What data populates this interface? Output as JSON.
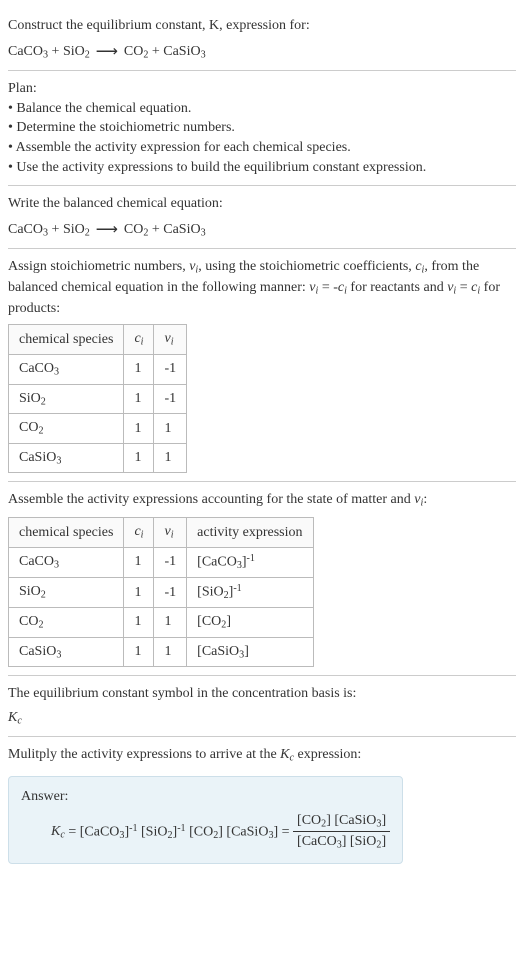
{
  "chart_data": [
    {
      "type": "table",
      "title": "stoichiometric numbers",
      "columns": [
        "chemical species",
        "c_i",
        "ν_i"
      ],
      "rows": [
        [
          "CaCO3",
          1,
          -1
        ],
        [
          "SiO2",
          1,
          -1
        ],
        [
          "CO2",
          1,
          1
        ],
        [
          "CaSiO3",
          1,
          1
        ]
      ]
    },
    {
      "type": "table",
      "title": "activity expressions",
      "columns": [
        "chemical species",
        "c_i",
        "ν_i",
        "activity expression"
      ],
      "rows": [
        [
          "CaCO3",
          1,
          -1,
          "[CaCO3]^-1"
        ],
        [
          "SiO2",
          1,
          -1,
          "[SiO2]^-1"
        ],
        [
          "CO2",
          1,
          1,
          "[CO2]"
        ],
        [
          "CaSiO3",
          1,
          1,
          "[CaSiO3]"
        ]
      ]
    }
  ],
  "s1": {
    "prompt": "Construct the equilibrium constant, K, expression for:"
  },
  "plan": {
    "heading": "Plan:",
    "b1": "• Balance the chemical equation.",
    "b2": "• Determine the stoichiometric numbers.",
    "b3": "• Assemble the activity expression for each chemical species.",
    "b4": "• Use the activity expressions to build the equilibrium constant expression."
  },
  "s3": {
    "prompt": "Write the balanced chemical equation:"
  },
  "s4": {
    "prompt_a": "Assign stoichiometric numbers, ",
    "prompt_b": ", using the stoichiometric coefficients, ",
    "prompt_c": ", from the balanced chemical equation in the following manner: ",
    "prompt_d": " for reactants and ",
    "prompt_e": " for products:",
    "h1": "chemical species",
    "r1c1": "CaCO",
    "r1c2": "1",
    "r1c3": "-1",
    "r2c1": "SiO",
    "r2c2": "1",
    "r2c3": "-1",
    "r3c1": "CO",
    "r3c2": "1",
    "r3c3": "1",
    "r4c1": "CaSiO",
    "r4c2": "1",
    "r4c3": "1"
  },
  "s5": {
    "prompt_a": "Assemble the activity expressions accounting for the state of matter and ",
    "prompt_b": ":",
    "h1": "chemical species",
    "h4": "activity expression",
    "r1c1": "CaCO",
    "r1c2": "1",
    "r1c3": "-1",
    "r2c1": "SiO",
    "r2c2": "1",
    "r2c3": "-1",
    "r3c1": "CO",
    "r3c2": "1",
    "r3c3": "1",
    "r4c1": "CaSiO",
    "r4c2": "1",
    "r4c3": "1"
  },
  "s6": {
    "prompt": "The equilibrium constant symbol in the concentration basis is:"
  },
  "s7": {
    "prompt_a": "Mulitply the activity expressions to arrive at the ",
    "prompt_b": " expression:",
    "answer_label": "Answer:"
  }
}
